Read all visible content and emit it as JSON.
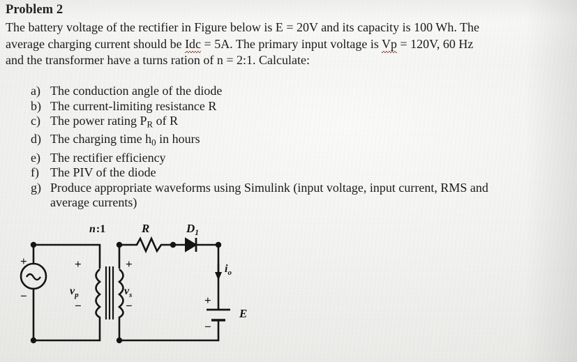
{
  "document": {
    "title": "Problem 2",
    "paragraph_lines": [
      "The battery voltage of the rectifier in Figure below is E = 20V and its capacity is 100 Wh. The",
      "average charging current should be Idc = 5A. The primary input voltage is Vp = 120V, 60 Hz",
      "and the transformer have a turns ration of n = 2:1. Calculate:"
    ],
    "line1_a": "The battery voltage of the rectifier in Figure below is E = 20V and its capacity is 100 Wh. The",
    "line2_a": "average charging current should be ",
    "line2_spell": "Idc",
    "line2_b": " = 5A. The primary input voltage is ",
    "line2_spell2": "Vp",
    "line2_c": " = 120V, 60 Hz",
    "line3_a": "and the transformer have a turns ration of n = 2:1. Calculate:",
    "values": {
      "battery_voltage": "E = 20V",
      "capacity": "100 Wh",
      "average_charging_current": "Idc = 5A",
      "primary_input_voltage": "Vp = 120V",
      "frequency": "60 Hz",
      "turns_ratio": "n = 2:1"
    },
    "list": [
      {
        "mark": "a)",
        "text_pre": "The conduction angle of the diode",
        "text_sub": "",
        "text_post": ""
      },
      {
        "mark": "b)",
        "text_pre": "The current-limiting resistance R",
        "text_sub": "",
        "text_post": ""
      },
      {
        "mark": "c)",
        "text_pre": "The power rating P",
        "text_sub": "R",
        "text_post": " of R"
      },
      {
        "mark": "d)",
        "text_pre": "The charging time h",
        "text_sub": "0",
        "text_post": " in hours"
      },
      {
        "mark": "e)",
        "text_pre": "The rectifier efficiency",
        "text_sub": "",
        "text_post": ""
      },
      {
        "mark": "f)",
        "text_pre": "The PIV of the diode",
        "text_sub": "",
        "text_post": ""
      }
    ],
    "list_last": {
      "mark": "g)",
      "line1": "Produce appropriate waveforms using Simulink (input voltage, input current, RMS and",
      "line2": "average currents)"
    }
  },
  "figure": {
    "name": "half-wave-battery-charger-circuit",
    "labels": {
      "turns_ratio": "n :1",
      "resistor": "R",
      "diode": "D",
      "diode_sub": "1",
      "primary_voltage": "v",
      "primary_voltage_sub": "p",
      "secondary_voltage": "v",
      "secondary_voltage_sub": "s",
      "output_current": "i",
      "output_current_sub": "o",
      "battery": "E",
      "plus": "+",
      "minus": "−"
    },
    "colors": {
      "wire": "#141414",
      "paper": "#f1f1ef"
    }
  }
}
